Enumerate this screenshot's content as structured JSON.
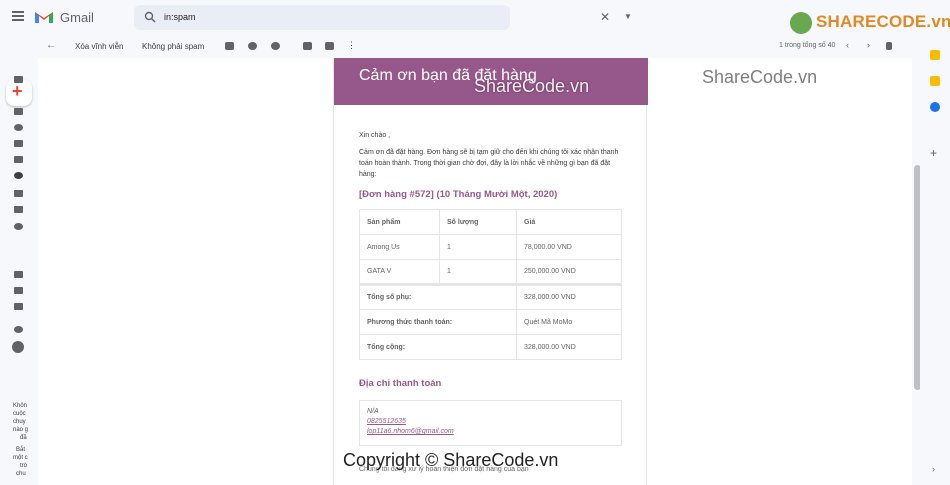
{
  "app": {
    "name": "Gmail",
    "search_value": "in:spam",
    "brand": "SHARECODE.vn"
  },
  "toolbar": {
    "delete_forever": "Xóa vĩnh viễn",
    "not_spam": "Không phải spam",
    "count": "1 trong tổng số 40"
  },
  "email": {
    "header": "Cảm ơn bạn đã đặt hàng",
    "greeting": "Xin chào ,",
    "intro": "Cảm ơn đã đặt hàng. Đơn hàng sẽ bị tạm giữ cho đến khi chúng tôi xác nhận thanh toán hoàn thành. Trong thời gian chờ đợi, đây là lời nhắc về những gì bạn đã đặt hàng:",
    "order_title": "[Đơn hàng #572] (10 Tháng Mười Một, 2020)",
    "table": {
      "headers": [
        "Sản phẩm",
        "Số lượng",
        "Giá"
      ],
      "rows": [
        [
          "Among Us",
          "1",
          "78,000.00 VND"
        ],
        [
          "GATA V",
          "1",
          "250,000.00 VND"
        ]
      ],
      "totals": [
        [
          "Tổng số phụ:",
          "328,000.00 VND"
        ],
        [
          "Phương thức thanh toán:",
          "Quét Mã MoMo"
        ],
        [
          "Tổng cộng:",
          "328,000.00 VND"
        ]
      ]
    },
    "address_title": "Địa chỉ thanh toán",
    "address_name": "N/A",
    "address_phone": "0825512635",
    "address_email": "lop11a6.nhom6@gmail.com",
    "footer": "Chúng tôi đang xử lý hoàn thiện đơn đặt hàng của bạn"
  },
  "watermarks": {
    "header": "ShareCode.vn",
    "right": "ShareCode.vn",
    "copyright": "Copyright © ShareCode.vn"
  },
  "leftrail_text": [
    "Khôn",
    "cuộc",
    "chuy",
    "nào g",
    "đã",
    "Bắt",
    "một c",
    "trò",
    "chu"
  ]
}
